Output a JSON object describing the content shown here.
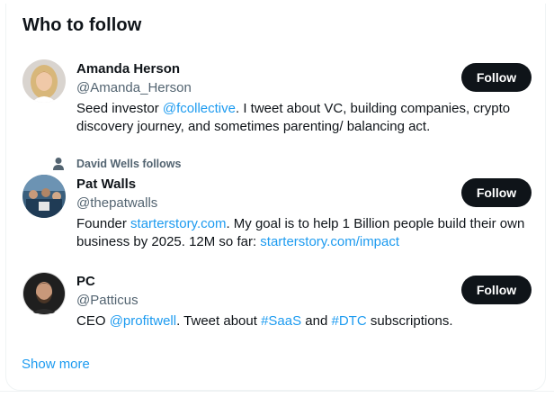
{
  "widget": {
    "title": "Who to follow",
    "show_more_label": "Show more",
    "accent_color": "#1d9bf0",
    "button_color": "#0f1419"
  },
  "accounts": [
    {
      "name": "Amanda Herson",
      "handle": "@Amanda_Herson",
      "follow_label": "Follow",
      "avatar_icon": "woman-portrait",
      "bio": {
        "t1": "Seed investor ",
        "l1": "@fcollective",
        "t2": ". I tweet about VC, building companies, crypto discovery journey, and sometimes parenting/ balancing act."
      }
    },
    {
      "social_context": "David Wells follows",
      "social_context_icon": "person-icon",
      "name": "Pat Walls",
      "handle": "@thepatwalls",
      "follow_label": "Follow",
      "avatar_icon": "group-photo",
      "bio": {
        "t1": "Founder ",
        "l1": "starterstory.com",
        "t2": ". My goal is to help 1 Billion people build their own business by 2025. 12M so far: ",
        "l2": "starterstory.com/impact"
      }
    },
    {
      "name": "PC",
      "handle": "@Patticus",
      "follow_label": "Follow",
      "avatar_icon": "man-portrait",
      "bio": {
        "t1": "CEO ",
        "l1": "@profitwell",
        "t2": ". Tweet about ",
        "l2": "#SaaS",
        "t3": " and ",
        "l3": "#DTC",
        "t4": " subscriptions."
      }
    }
  ]
}
